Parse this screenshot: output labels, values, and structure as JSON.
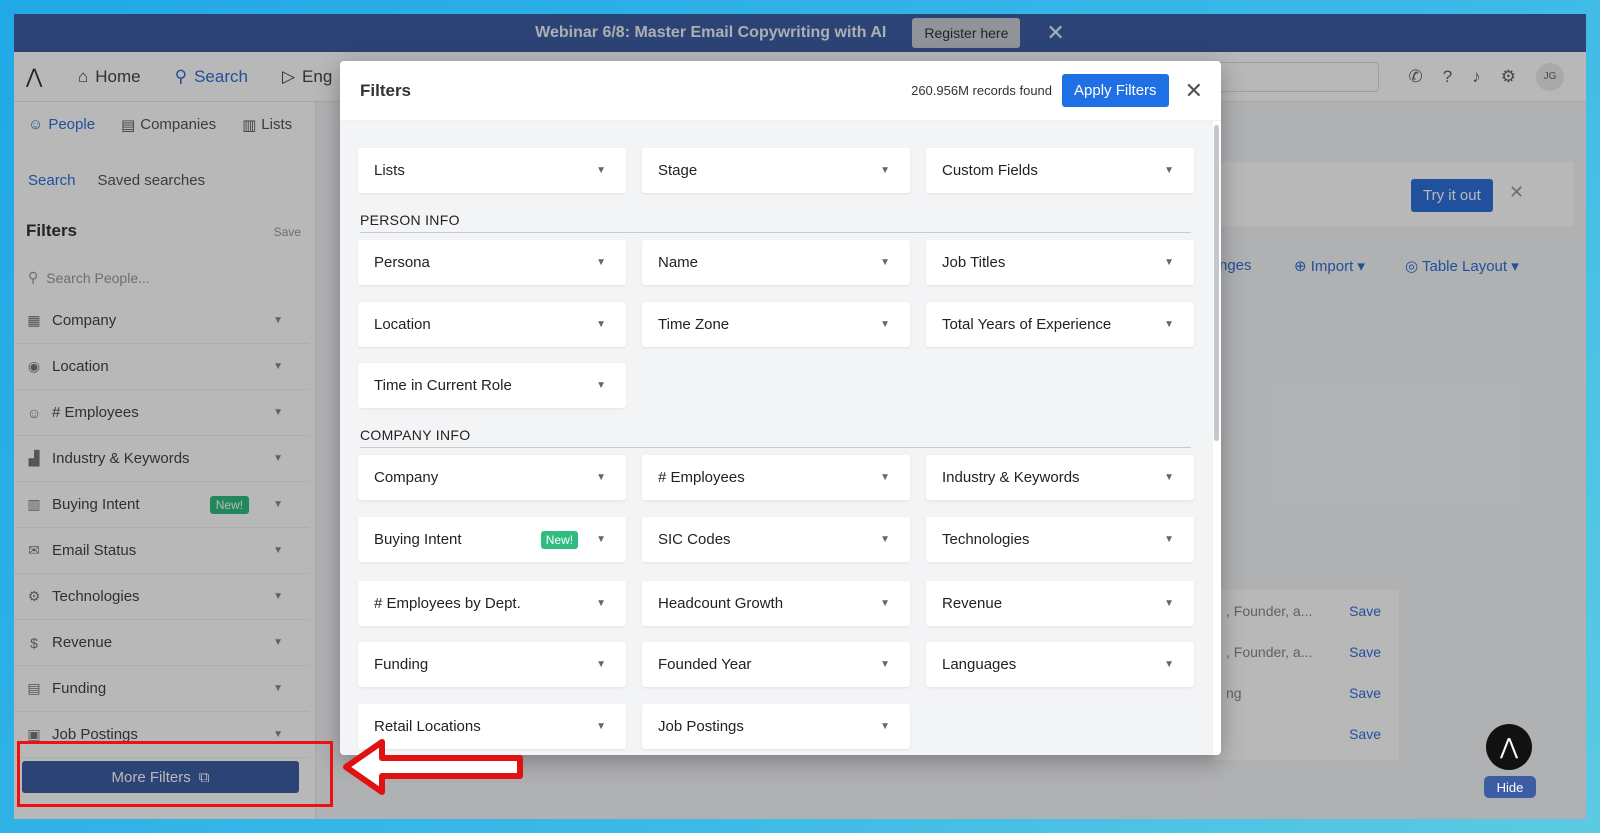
{
  "banner": {
    "text": "Webinar 6/8: Master Email Copywriting with AI",
    "register": "Register here",
    "close": "✕"
  },
  "nav": {
    "items": [
      {
        "label": "Home",
        "icon": "home-icon"
      },
      {
        "label": "Search",
        "icon": "search-icon"
      },
      {
        "label": "Eng",
        "icon": "send-icon"
      }
    ],
    "avatar": "JG"
  },
  "sidebar": {
    "tabs": [
      "People",
      "Companies",
      "Lists"
    ],
    "subtabs": [
      "Search",
      "Saved searches"
    ],
    "filters_title": "Filters",
    "save": "Save",
    "search_placeholder": "Search People...",
    "items": [
      {
        "label": "Company",
        "icon": "building-icon"
      },
      {
        "label": "Location",
        "icon": "pin-icon"
      },
      {
        "label": "# Employees",
        "icon": "users-icon"
      },
      {
        "label": "Industry & Keywords",
        "icon": "factory-icon"
      },
      {
        "label": "Buying Intent",
        "icon": "chart-icon",
        "badge": "New!"
      },
      {
        "label": "Email Status",
        "icon": "mail-icon"
      },
      {
        "label": "Technologies",
        "icon": "tech-icon"
      },
      {
        "label": "Revenue",
        "icon": "dollar-icon"
      },
      {
        "label": "Funding",
        "icon": "funding-icon"
      },
      {
        "label": "Job Postings",
        "icon": "job-icon"
      }
    ],
    "more_filters": "More Filters"
  },
  "background": {
    "try_it": "Try it out",
    "import": "Import",
    "table_layout": "Table Layout",
    "changes": "nges",
    "rows": [
      {
        "text": ", Founder, a...",
        "save": "Save"
      },
      {
        "text": ", Founder, a...",
        "save": "Save"
      },
      {
        "text": "ng",
        "save": "Save"
      },
      {
        "text": "",
        "save": "Save"
      }
    ],
    "hide": "Hide"
  },
  "modal": {
    "title": "Filters",
    "records": "260.956M records found",
    "apply": "Apply Filters",
    "top": [
      "Lists",
      "Stage",
      "Custom Fields"
    ],
    "person_section": "PERSON INFO",
    "person": [
      [
        "Persona",
        "Name",
        "Job Titles"
      ],
      [
        "Location",
        "Time Zone",
        "Total Years of Experience"
      ],
      [
        "Time in Current Role"
      ]
    ],
    "company_section": "COMPANY INFO",
    "company": [
      [
        "Company",
        "# Employees",
        "Industry & Keywords"
      ],
      [
        "Buying Intent",
        "SIC Codes",
        "Technologies"
      ],
      [
        "# Employees by Dept.",
        "Headcount Growth",
        "Revenue"
      ],
      [
        "Funding",
        "Founded Year",
        "Languages"
      ],
      [
        "Retail Locations",
        "Job Postings"
      ]
    ],
    "new_badge": "New!"
  },
  "colors": {
    "accent": "#1f6fe5",
    "banner": "#3c5da3",
    "badge": "#2ebd7f",
    "annotation": "#e11111"
  }
}
